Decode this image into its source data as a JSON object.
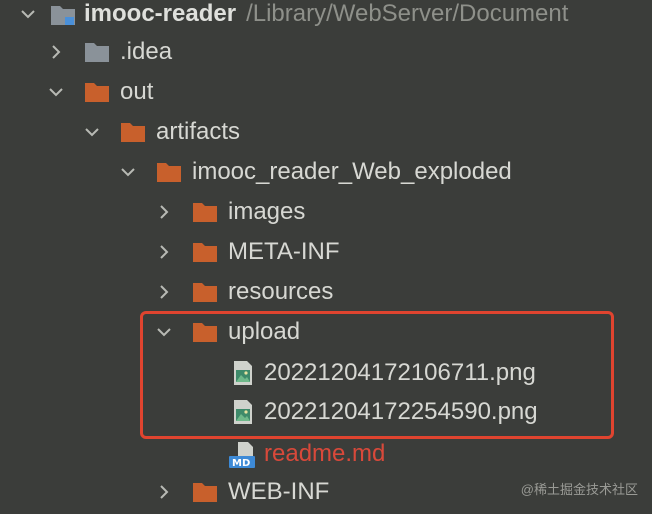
{
  "tree": {
    "root": {
      "name": "imooc-reader",
      "path": "/Library/WebServer/Document"
    },
    "items": [
      {
        "label": ".idea",
        "icon": "folder-icon-gray",
        "expanded": false
      },
      {
        "label": "out",
        "icon": "folder-icon-orange",
        "expanded": true
      },
      {
        "label": "artifacts",
        "icon": "folder-icon-orange",
        "expanded": true
      },
      {
        "label": "imooc_reader_Web_exploded",
        "icon": "folder-icon-orange",
        "expanded": true
      },
      {
        "label": "images",
        "icon": "folder-icon-orange",
        "expanded": false
      },
      {
        "label": "META-INF",
        "icon": "folder-icon-orange",
        "expanded": false
      },
      {
        "label": "resources",
        "icon": "folder-icon-orange",
        "expanded": false
      },
      {
        "label": "upload",
        "icon": "folder-icon-orange",
        "expanded": true
      },
      {
        "label": "20221204172106711.png",
        "icon": "image-file-icon"
      },
      {
        "label": "20221204172254590.png",
        "icon": "image-file-icon"
      },
      {
        "label": "readme.md",
        "icon": "markdown-file-icon"
      },
      {
        "label": "WEB-INF",
        "icon": "folder-icon-orange",
        "expanded": false
      }
    ]
  },
  "colors": {
    "background": "#3b3d3a",
    "folder_orange": "#c8602c",
    "folder_gray": "#8a9299",
    "highlight_red": "#e0442f",
    "modified_text_red": "#d8493a"
  },
  "watermark": "@稀土掘金技术社区"
}
